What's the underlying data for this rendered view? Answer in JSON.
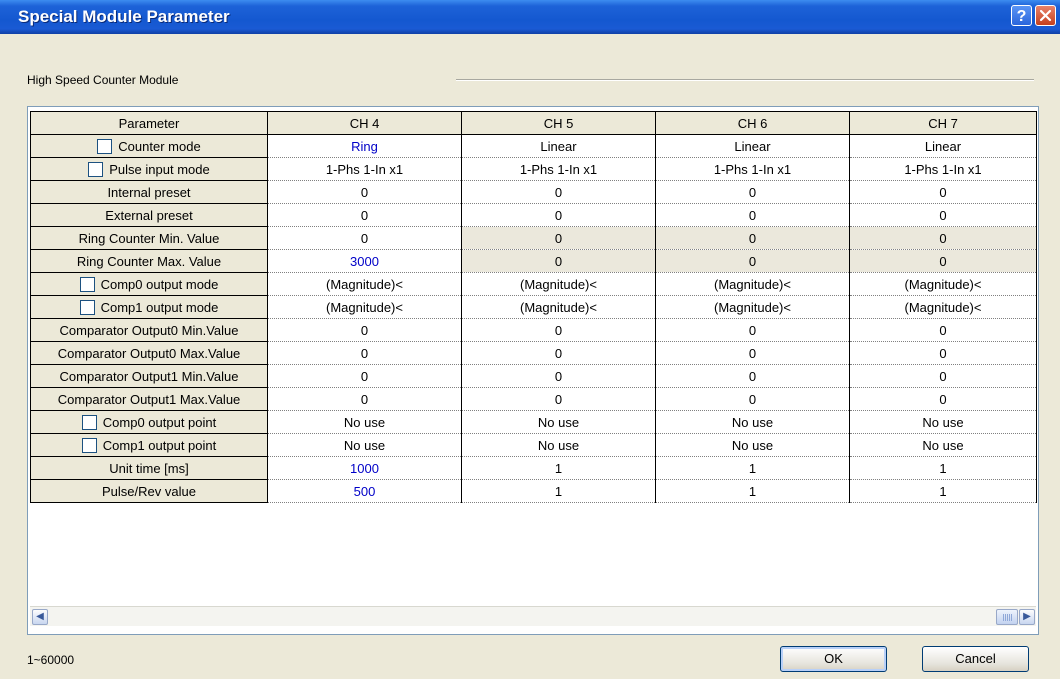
{
  "window": {
    "title": "Special Module Parameter"
  },
  "group": {
    "label": "High Speed Counter Module"
  },
  "table": {
    "headers": [
      "Parameter",
      "CH 4",
      "CH 5",
      "CH 6",
      "CH 7"
    ],
    "rows": [
      {
        "label": "Counter mode",
        "checkbox": true,
        "values": [
          "Ring",
          "Linear",
          "Linear",
          "Linear"
        ]
      },
      {
        "label": "Pulse input mode",
        "checkbox": true,
        "values": [
          "1-Phs 1-In x1",
          "1-Phs 1-In x1",
          "1-Phs 1-In x1",
          "1-Phs 1-In x1"
        ]
      },
      {
        "label": "Internal preset",
        "checkbox": false,
        "values": [
          "0",
          "0",
          "0",
          "0"
        ]
      },
      {
        "label": "External preset",
        "checkbox": false,
        "values": [
          "0",
          "0",
          "0",
          "0"
        ]
      },
      {
        "label": "Ring Counter Min. Value",
        "checkbox": false,
        "values": [
          "0",
          "0",
          "0",
          "0"
        ]
      },
      {
        "label": "Ring Counter Max. Value",
        "checkbox": false,
        "values": [
          "3000",
          "0",
          "0",
          "0"
        ]
      },
      {
        "label": "Comp0 output mode",
        "checkbox": true,
        "values": [
          "(Magnitude)<",
          "(Magnitude)<",
          "(Magnitude)<",
          "(Magnitude)<"
        ]
      },
      {
        "label": "Comp1 output mode",
        "checkbox": true,
        "values": [
          "(Magnitude)<",
          "(Magnitude)<",
          "(Magnitude)<",
          "(Magnitude)<"
        ]
      },
      {
        "label": "Comparator Output0 Min.Value",
        "checkbox": false,
        "values": [
          "0",
          "0",
          "0",
          "0"
        ]
      },
      {
        "label": "Comparator Output0 Max.Value",
        "checkbox": false,
        "values": [
          "0",
          "0",
          "0",
          "0"
        ]
      },
      {
        "label": "Comparator Output1 Min.Value",
        "checkbox": false,
        "values": [
          "0",
          "0",
          "0",
          "0"
        ]
      },
      {
        "label": "Comparator Output1 Max.Value",
        "checkbox": false,
        "values": [
          "0",
          "0",
          "0",
          "0"
        ]
      },
      {
        "label": "Comp0 output point",
        "checkbox": true,
        "values": [
          "No use",
          "No use",
          "No use",
          "No use"
        ]
      },
      {
        "label": "Comp1 output point",
        "checkbox": true,
        "values": [
          "No use",
          "No use",
          "No use",
          "No use"
        ]
      },
      {
        "label": "Unit time [ms]",
        "checkbox": false,
        "values": [
          "1000",
          "1",
          "1",
          "1"
        ]
      },
      {
        "label": "Pulse/Rev value",
        "checkbox": false,
        "values": [
          "500",
          "1",
          "1",
          "1"
        ]
      }
    ]
  },
  "status": {
    "range": "1~60000"
  },
  "buttons": {
    "ok": "OK",
    "cancel": "Cancel",
    "help": "?"
  },
  "icons": {
    "help": "help-icon",
    "close": "close-icon",
    "scroll_left": "arrow-left-icon",
    "scroll_right": "arrow-right-icon"
  },
  "colors": {
    "titlebar": "#1458d0",
    "modified_value": "#0000c8",
    "disabled_cell": "#ebe8dc"
  }
}
